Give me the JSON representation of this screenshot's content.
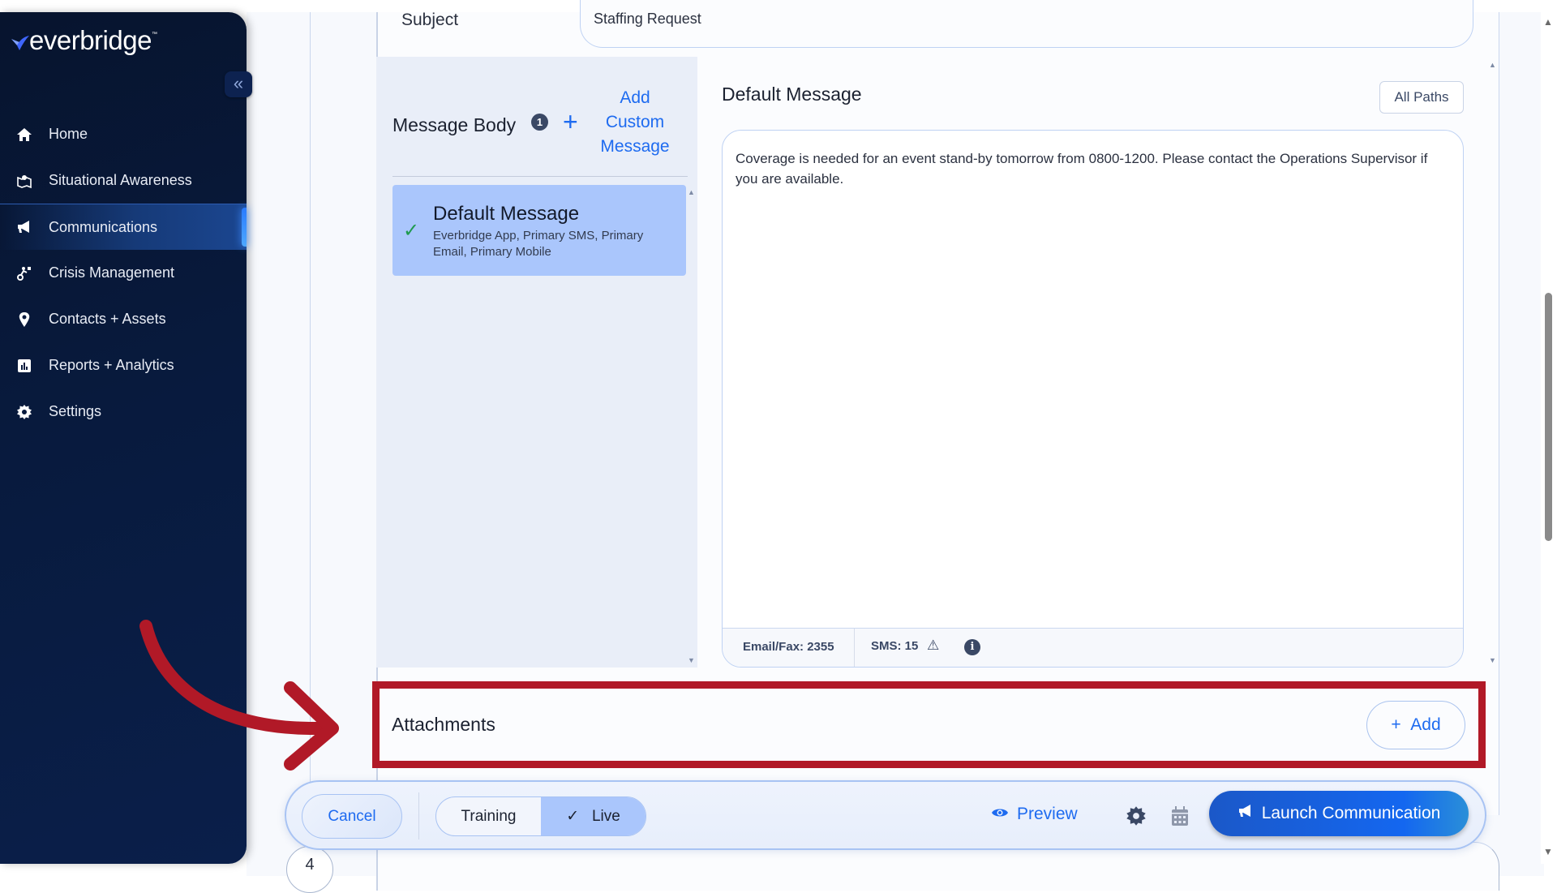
{
  "brand": {
    "name": "everbridge",
    "tm": "™"
  },
  "sidebar": {
    "collapse_icon": "«",
    "items": [
      {
        "label": "Home",
        "icon": "home-icon",
        "active": false
      },
      {
        "label": "Situational Awareness",
        "icon": "map-pin-icon",
        "active": false
      },
      {
        "label": "Communications",
        "icon": "megaphone-icon",
        "active": true
      },
      {
        "label": "Crisis Management",
        "icon": "route-icon",
        "active": false
      },
      {
        "label": "Contacts + Assets",
        "icon": "location-pin-icon",
        "active": false
      },
      {
        "label": "Reports + Analytics",
        "icon": "bar-chart-icon",
        "active": false
      },
      {
        "label": "Settings",
        "icon": "gear-icon",
        "active": false
      }
    ]
  },
  "form": {
    "subject_label": "Subject",
    "subject_value": "Staffing Request",
    "message_body": {
      "title": "Message Body",
      "count_badge": "1",
      "add_custom_label": "Add Custom Message",
      "items": [
        {
          "title": "Default Message",
          "paths": "Everbridge App, Primary SMS, Primary Email, Primary Mobile",
          "selected": true
        }
      ]
    },
    "editor": {
      "title": "Default Message",
      "all_paths_label": "All Paths",
      "text": "Coverage is needed for an event stand-by tomorrow from 0800-1200. Please contact the Operations Supervisor if you are available.",
      "email_fax_count": "Email/Fax: 2355",
      "sms_count": "SMS: 15"
    },
    "attachments": {
      "title": "Attachments",
      "add_label": "Add"
    }
  },
  "bottom_bar": {
    "cancel_label": "Cancel",
    "mode_options": [
      {
        "label": "Training",
        "selected": false
      },
      {
        "label": "Live",
        "selected": true
      }
    ],
    "preview_label": "Preview",
    "launch_label": "Launch Communication"
  },
  "next_step_number": "4",
  "colors": {
    "accent": "#1e6bf0",
    "sidebar_bg": "#081a3d",
    "highlight_red": "#b11927",
    "selected_item": "#aac6fc",
    "check_green": "#1f9a4e"
  }
}
